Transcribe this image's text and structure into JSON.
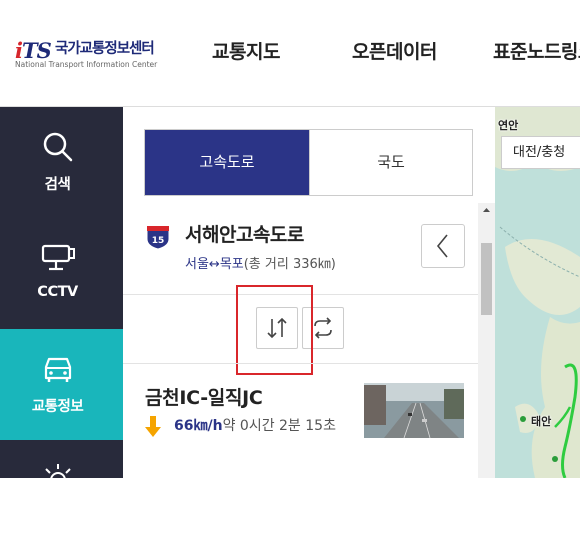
{
  "header": {
    "logo_mark": "iTS",
    "logo_kr": "국가교통정보센터",
    "logo_en": "National Transport Information Center",
    "nav": [
      "교통지도",
      "오픈데이터",
      "표준노드링크"
    ]
  },
  "rail": {
    "items": [
      {
        "label": "검색",
        "icon": "search-icon"
      },
      {
        "label": "CCTV",
        "icon": "cctv-camera-icon"
      },
      {
        "label": "교통정보",
        "icon": "car-icon",
        "active": true
      },
      {
        "label": "",
        "icon": "sun-icon"
      }
    ]
  },
  "panel": {
    "tabs": {
      "highway": "고속도로",
      "national": "국도",
      "active": "highway"
    },
    "route": {
      "shield_number": "15",
      "name": "서해안고속도로",
      "endpoints": "서울↔목포",
      "distance": "(총 거리 336㎞)"
    },
    "direction_buttons": {
      "swap_icon": "up-down-arrows-icon",
      "refresh_icon": "cycle-arrows-icon"
    },
    "segment": {
      "title": "금천IC-일직JC",
      "speed_value": "66",
      "speed_unit": "㎞/h",
      "time_text": "약 0시간 2분 15초",
      "trend_icon": "down-arrow-icon",
      "trend_color": "#f5a400"
    }
  },
  "map": {
    "region_button": "대전/충청",
    "labels": [
      "연안",
      "태안"
    ]
  },
  "colors": {
    "rail_bg": "#282a3b",
    "rail_active": "#19b6bb",
    "tab_active": "#2b3487",
    "highlight": "#d9262b"
  }
}
